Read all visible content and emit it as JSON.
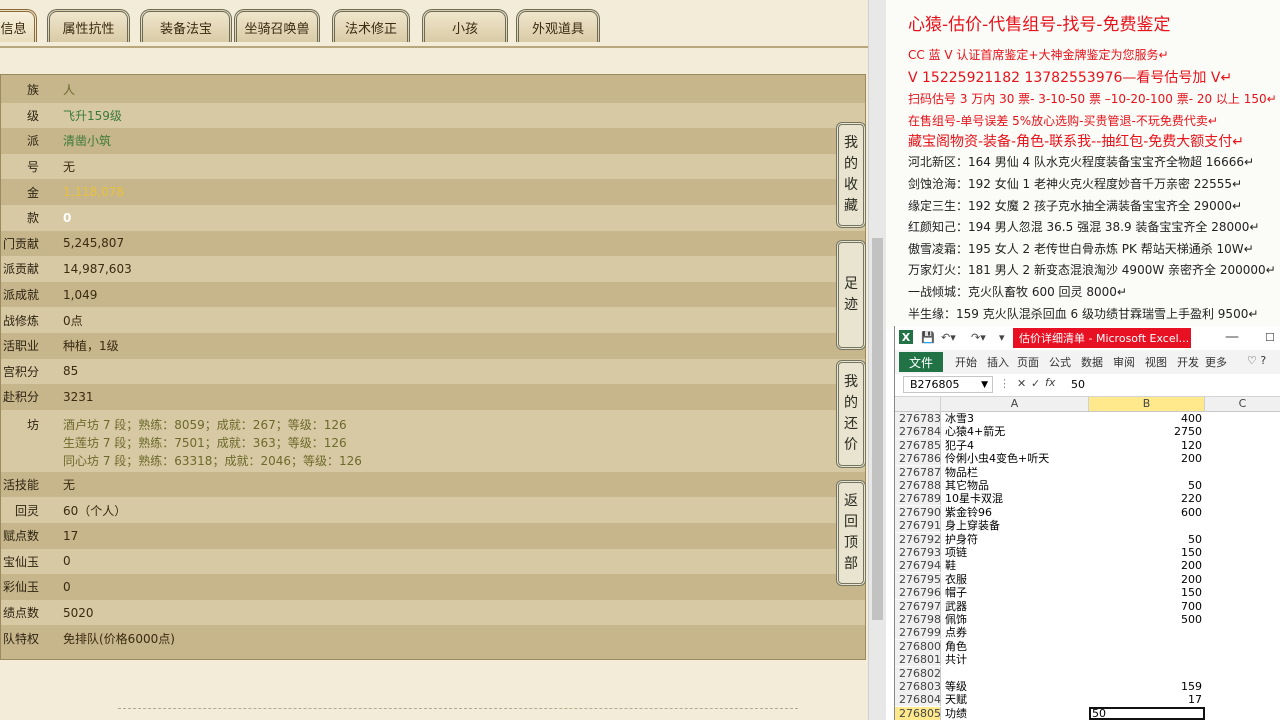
{
  "game": {
    "tabs": [
      "信息",
      "属性抗性",
      "装备法宝",
      "坐骑召唤兽",
      "法术修正",
      "小孩",
      "外观道具"
    ],
    "rows": [
      {
        "label": "族",
        "value": "人",
        "style": "olive"
      },
      {
        "label": "级",
        "value": "飞升159级",
        "style": "green"
      },
      {
        "label": "派",
        "value": "清凿小筑",
        "style": "green"
      },
      {
        "label": "号",
        "value": "无",
        "style": "plain"
      },
      {
        "label": "金",
        "value": "1,118,078",
        "style": "gold"
      },
      {
        "label": "款",
        "value": "0",
        "style": "white"
      },
      {
        "label": "门贡献",
        "value": "5,245,807",
        "style": "plain"
      },
      {
        "label": "派贡献",
        "value": "14,987,603",
        "style": "plain"
      },
      {
        "label": "派成就",
        "value": "1,049",
        "style": "plain"
      },
      {
        "label": "战修炼",
        "value": "0点",
        "style": "plain"
      },
      {
        "label": "活职业",
        "value": "种植，1级",
        "style": "plain"
      },
      {
        "label": "宫积分",
        "value": "85",
        "style": "plain"
      },
      {
        "label": "赴积分",
        "value": "3231",
        "style": "plain"
      }
    ],
    "workshop": {
      "label": "坊",
      "lines": [
        "酒卢坊 7 段；熟练：8059；成就：267；等级：126",
        "生莲坊 7 段；熟练：7501；成就：363；等级：126",
        "同心坊 7 段；熟练：63318；成就：2046；等级：126"
      ]
    },
    "rows2": [
      {
        "label": "活技能",
        "value": "无",
        "style": "plain"
      },
      {
        "label": "回灵",
        "value": "60（个人）",
        "style": "plain"
      },
      {
        "label": "赋点数",
        "value": "17",
        "style": "plain"
      },
      {
        "label": "宝仙玉",
        "value": "0",
        "style": "plain"
      },
      {
        "label": "彩仙玉",
        "value": "0",
        "style": "plain"
      },
      {
        "label": "绩点数",
        "value": "5020",
        "style": "plain"
      },
      {
        "label": "队特权",
        "value": "免排队(价格6000点)",
        "style": "plain"
      }
    ],
    "side_buttons": [
      {
        "name": "favorites",
        "chars": [
          "我",
          "的",
          "收",
          "藏"
        ]
      },
      {
        "name": "footprint",
        "chars": [
          "足",
          "迹"
        ]
      },
      {
        "name": "bargain",
        "chars": [
          "我",
          "的",
          "还",
          "价"
        ]
      },
      {
        "name": "back-to-top",
        "chars": [
          "返",
          "回",
          "顶",
          "部"
        ]
      }
    ]
  },
  "ad": {
    "title": "心猿-估价-代售组号-找号-免费鉴定",
    "lines": [
      {
        "text": "CC 蓝 V 认证首席鉴定+大神金牌鉴定为您服务↵",
        "cls": "ad-red"
      },
      {
        "text": "V 15225921182      13782553976—看号估号加 V↵",
        "cls": "ad-red ad-big"
      },
      {
        "text": "扫码估号 3 万内 30 票- 3-10-50 票  –10-20-100 票- 20 以上 150↵",
        "cls": "ad-red"
      },
      {
        "text": "在售组号-单号误差 5%放心选购-买贵管退-不玩免费代卖↵",
        "cls": "ad-red"
      },
      {
        "text": "藏宝阁物资-装备-角色-联系我--抽红包-免费大额支付↵",
        "cls": "ad-red ad-big"
      },
      {
        "text": "河北新区：164 男仙 4 队水克火程度装备宝宝齐全物超 16666↵",
        "cls": ""
      },
      {
        "text": "剑蚀沧海：192 女仙 1 老神火克火程度妙音千万亲密 22555↵",
        "cls": ""
      },
      {
        "text": "缘定三生：192 女魔 2 孩子克水抽全满装备宝宝齐全 29000↵",
        "cls": ""
      },
      {
        "text": "红颜知己：194 男人忽混 36.5 强混 38.9 装备宝宝齐全 28000↵",
        "cls": ""
      },
      {
        "text": "傲雪凌霜：195 女人 2 老传世白骨赤炼 PK 帮站天梯通杀 10W↵",
        "cls": ""
      },
      {
        "text": "万家灯火：181 男人 2 新变态混浪淘沙 4900W 亲密齐全 200000↵",
        "cls": ""
      },
      {
        "text": "一战倾城：克火队畜牧 600 回灵 8000↵",
        "cls": ""
      },
      {
        "text": "半生缘：159 克火队混杀回血 6 级功绩甘霖瑞雪上手盈利 9500↵",
        "cls": ""
      }
    ]
  },
  "excel": {
    "title": "估价详细清单 - Microsoft Excel...",
    "ribbon_tabs": [
      "文件",
      "开始",
      "插入",
      "页面",
      "公式",
      "数据",
      "审阅",
      "视图",
      "开发",
      "更多"
    ],
    "name_box": "B276805",
    "formula": "50",
    "columns": [
      "A",
      "B",
      "C"
    ],
    "rows": [
      {
        "n": "276783",
        "a": "冰雪3",
        "b": "400"
      },
      {
        "n": "276784",
        "a": "心猿4+箭无",
        "b": "2750"
      },
      {
        "n": "276785",
        "a": "犯子4",
        "b": "120"
      },
      {
        "n": "276786",
        "a": "伶俐小虫4变色+听天",
        "b": "200"
      },
      {
        "n": "276787",
        "a": "物品栏",
        "b": ""
      },
      {
        "n": "276788",
        "a": "其它物品",
        "b": "50"
      },
      {
        "n": "276789",
        "a": "10星卡双混",
        "b": "220"
      },
      {
        "n": "276790",
        "a": "紫金铃96",
        "b": "600"
      },
      {
        "n": "276791",
        "a": "身上穿装备",
        "b": ""
      },
      {
        "n": "276792",
        "a": "护身符",
        "b": "50"
      },
      {
        "n": "276793",
        "a": "项链",
        "b": "150"
      },
      {
        "n": "276794",
        "a": "鞋",
        "b": "200"
      },
      {
        "n": "276795",
        "a": "衣服",
        "b": "200"
      },
      {
        "n": "276796",
        "a": "帽子",
        "b": "150"
      },
      {
        "n": "276797",
        "a": "武器",
        "b": "700"
      },
      {
        "n": "276798",
        "a": "佩饰",
        "b": "500"
      },
      {
        "n": "276799",
        "a": "点券",
        "b": ""
      },
      {
        "n": "276800",
        "a": "角色",
        "b": ""
      },
      {
        "n": "276801",
        "a": "共计",
        "b": ""
      },
      {
        "n": "276802",
        "a": "",
        "b": ""
      },
      {
        "n": "276803",
        "a": "等级",
        "b": "159"
      },
      {
        "n": "276804",
        "a": "天赋",
        "b": "17"
      },
      {
        "n": "276805",
        "a": "功绩",
        "b": "50"
      }
    ]
  }
}
